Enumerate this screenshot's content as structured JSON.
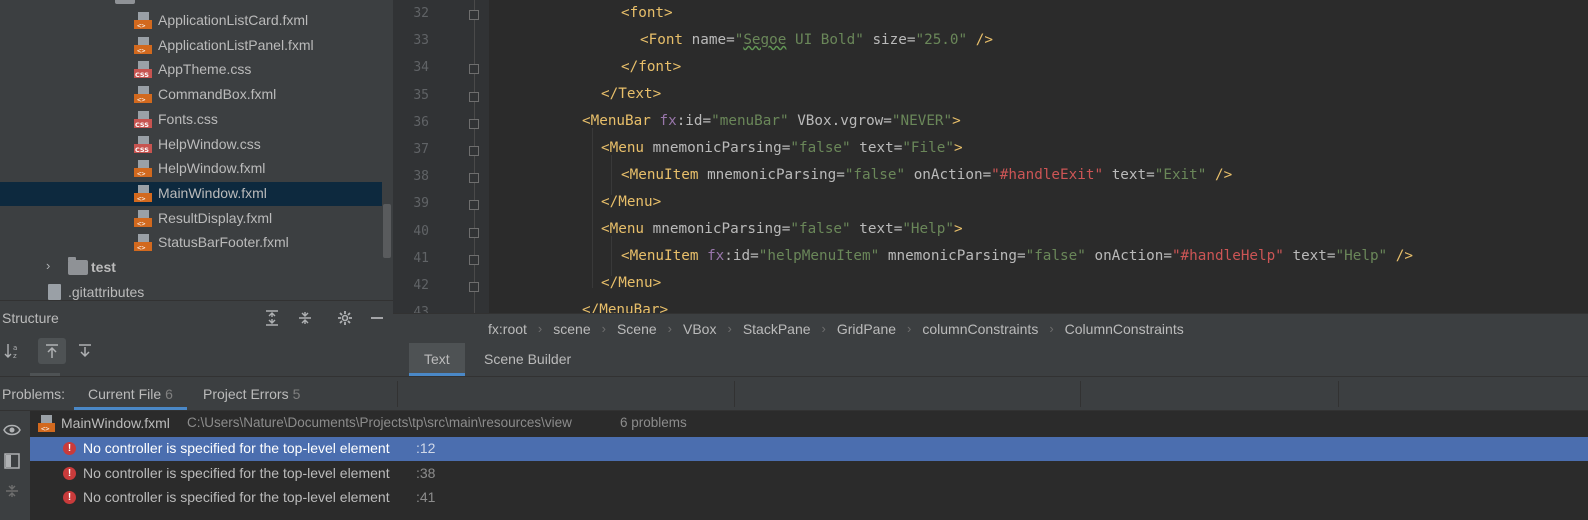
{
  "tree": {
    "items": [
      {
        "label": "ApplicationListCard.fxml",
        "kind": "fxml"
      },
      {
        "label": "ApplicationListPanel.fxml",
        "kind": "fxml"
      },
      {
        "label": "AppTheme.css",
        "kind": "css"
      },
      {
        "label": "CommandBox.fxml",
        "kind": "fxml"
      },
      {
        "label": "Fonts.css",
        "kind": "css"
      },
      {
        "label": "HelpWindow.css",
        "kind": "css"
      },
      {
        "label": "HelpWindow.fxml",
        "kind": "fxml"
      },
      {
        "label": "MainWindow.fxml",
        "kind": "fxml",
        "selected": true
      },
      {
        "label": "ResultDisplay.fxml",
        "kind": "fxml"
      },
      {
        "label": "StatusBarFooter.fxml",
        "kind": "fxml"
      }
    ],
    "folder_test": "test",
    "gitattributes": ".gitattributes"
  },
  "structure": {
    "title": "Structure"
  },
  "editor": {
    "line_numbers": [
      "32",
      "33",
      "34",
      "35",
      "36",
      "37",
      "38",
      "39",
      "40",
      "41",
      "42",
      "43"
    ]
  },
  "breadcrumb": [
    "fx:root",
    "scene",
    "Scene",
    "VBox",
    "StackPane",
    "GridPane",
    "columnConstraints",
    "ColumnConstraints"
  ],
  "editor_tabs": {
    "text": "Text",
    "scene_builder": "Scene Builder"
  },
  "problems": {
    "label": "Problems:",
    "tab_current": "Current File",
    "tab_current_count": "6",
    "tab_project": "Project Errors",
    "tab_project_count": "5",
    "file_name": "MainWindow.fxml",
    "file_path": "C:\\Users\\Nature\\Documents\\Projects\\tp\\src\\main\\resources\\view",
    "file_count": "6 problems",
    "items": [
      {
        "message": "No controller is specified for the top-level element",
        "line": ":12"
      },
      {
        "message": "No controller is specified for the top-level element",
        "line": ":38"
      },
      {
        "message": "No controller is specified for the top-level element",
        "line": ":41"
      }
    ]
  },
  "colors": {
    "selection_blue": "#4b6eaf",
    "tree_selection": "#0d293e",
    "error_red": "#c93b3b",
    "tab_underline": "#4a88c7"
  }
}
